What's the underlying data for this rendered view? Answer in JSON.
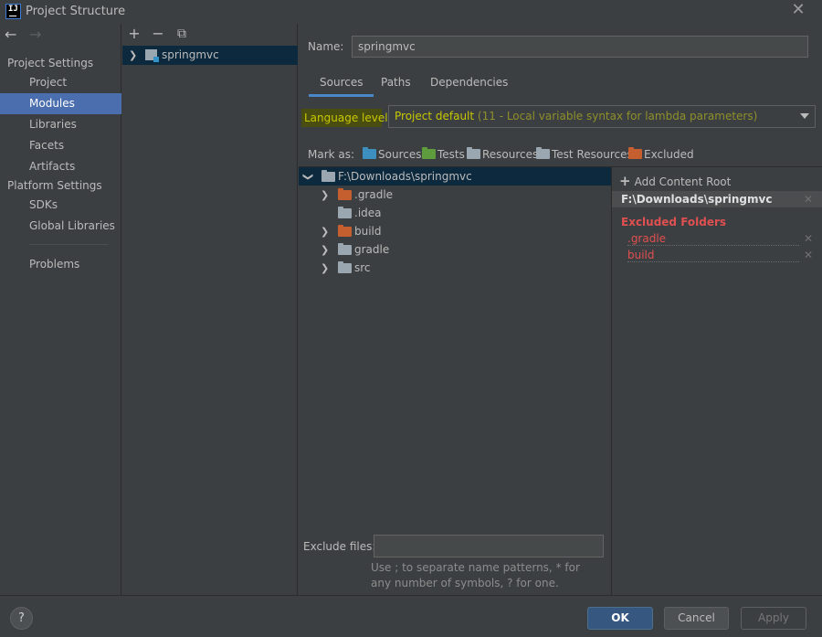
{
  "window": {
    "logo": "IJ",
    "title": "Project Structure",
    "close": "✕"
  },
  "nav": {
    "back": "←",
    "forward": "→",
    "project_settings_header": "Project Settings",
    "project_settings_items": [
      "Project",
      "Modules",
      "Libraries",
      "Facets",
      "Artifacts"
    ],
    "platform_settings_header": "Platform Settings",
    "platform_settings_items": [
      "SDKs",
      "Global Libraries"
    ],
    "problems": "Problems",
    "selected": "Modules"
  },
  "modules": {
    "toolbar": {
      "add": "+",
      "remove": "−",
      "copy": "⧉"
    },
    "items": [
      {
        "name": "springmvc",
        "expanded": false
      }
    ]
  },
  "module_settings": {
    "name_label": "Name:",
    "name_value": "springmvc",
    "tabs": [
      "Sources",
      "Paths",
      "Dependencies"
    ],
    "active_tab": "Sources",
    "language_level_label": "Language level:",
    "language_level_value": "Project default",
    "language_level_detail": "(11 - Local variable syntax for lambda parameters)",
    "mark_as_label": "Mark as:",
    "mark_as": [
      {
        "label": "Sources",
        "color": "#3d8fbf"
      },
      {
        "label": "Tests",
        "color": "#5f9c3e"
      },
      {
        "label": "Resources",
        "color": "#9aa7b0"
      },
      {
        "label": "Test Resources",
        "color": "#9aa7b0"
      },
      {
        "label": "Excluded",
        "color": "#c55f2f"
      }
    ],
    "tree": {
      "root": "F:\\Downloads\\springmvc",
      "children": [
        {
          "name": ".gradle",
          "excluded": true,
          "expandable": true
        },
        {
          "name": ".idea",
          "excluded": false,
          "expandable": false
        },
        {
          "name": "build",
          "excluded": true,
          "expandable": true
        },
        {
          "name": "gradle",
          "excluded": false,
          "expandable": true
        },
        {
          "name": "src",
          "excluded": false,
          "expandable": true
        }
      ]
    },
    "content_root": {
      "add_label": "Add Content Root",
      "path": "F:\\Downloads\\springmvc",
      "excluded_header": "Excluded Folders",
      "excluded": [
        ".gradle",
        "build"
      ]
    },
    "exclude_files_label": "Exclude files:",
    "exclude_files_value": "",
    "exclude_hint": "Use ; to separate name patterns, * for any number of symbols, ? for one."
  },
  "footer": {
    "help": "?",
    "ok": "OK",
    "cancel": "Cancel",
    "apply": "Apply"
  },
  "colors": {
    "selection": "#4b6eaf",
    "tree_selection": "#0d293e",
    "excluded_folder": "#c55f2f",
    "plain_folder": "#9aa7b0",
    "highlight": "#c8c800",
    "excluded_text": "#e05050"
  }
}
